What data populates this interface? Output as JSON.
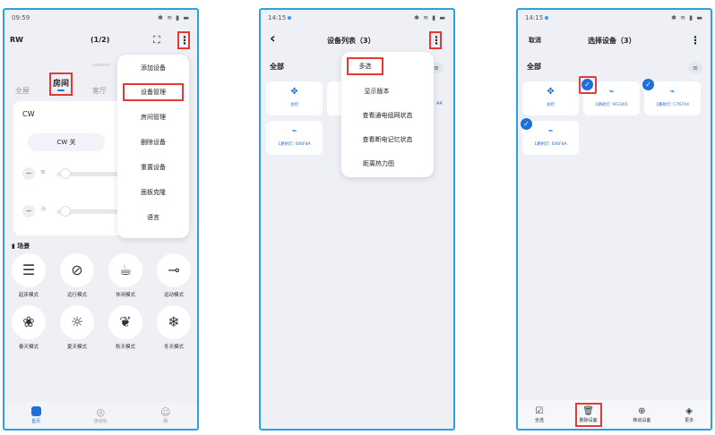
{
  "phone1": {
    "status_time": "09:59",
    "status_icons": "✱ ≋ ▮ ▬",
    "home_name": "RW",
    "page_indicator": "(1/2)",
    "scan_icon": "scan-icon",
    "tabs": [
      "全屋",
      "房间",
      "客厅"
    ],
    "card_title": "CW",
    "cw_toggle_label": "CW 关",
    "brightness_minus": "−",
    "temp_minus": "−",
    "scene_section": "场景",
    "scenes": [
      {
        "label": "起床模式",
        "glyph": "☰"
      },
      {
        "label": "远行模式",
        "glyph": "⊘"
      },
      {
        "label": "休闲模式",
        "glyph": "☕"
      },
      {
        "label": "运动模式",
        "glyph": "⊸"
      },
      {
        "label": "春天模式",
        "glyph": "❀"
      },
      {
        "label": "夏天模式",
        "glyph": "☼"
      },
      {
        "label": "秋天模式",
        "glyph": "❦"
      },
      {
        "label": "冬天模式",
        "glyph": "❄"
      }
    ],
    "menu_items": [
      "添加设备",
      "设备管理",
      "房间管理",
      "删除设备",
      "重置设备",
      "面板克隆",
      "语言"
    ],
    "nav": [
      {
        "label": "首页"
      },
      {
        "label": "自动化",
        "glyph": "◎"
      },
      {
        "label": "我",
        "glyph": "☺"
      }
    ]
  },
  "phone2": {
    "status_time": "14:15",
    "status_icons": "✱ ≋ ▮ ▬",
    "back_glyph": "‹",
    "title": "设备列表（3）",
    "section": "全部",
    "devices": [
      {
        "label": "总控",
        "glyph": "✥"
      },
      {
        "label": "1路射灯: E06F8A",
        "glyph": "⌁"
      }
    ],
    "menu_items": [
      "多选",
      "显示版本",
      "查看通电组网状态",
      "查看断电记忆状态",
      "距离热力图"
    ],
    "hidden_suffix": "A4"
  },
  "phone3": {
    "status_time": "14:15",
    "status_icons": "✱ ≋ ▮ ▬",
    "cancel": "取消",
    "title": "选择设备（3）",
    "section": "全部",
    "devices": [
      {
        "label": "总控",
        "glyph": "✥"
      },
      {
        "label": "1路射灯: 9F2365",
        "glyph": "⌁"
      },
      {
        "label": "1路射灯: C767A4",
        "glyph": "⌁"
      },
      {
        "label": "1路射灯: E06F8A",
        "glyph": "⌁"
      }
    ],
    "bottom_actions": [
      {
        "label": "全选",
        "glyph": "☑"
      },
      {
        "label": "删除设备",
        "glyph": "🗑"
      },
      {
        "label": "移动设备",
        "glyph": "⊕"
      },
      {
        "label": "更多",
        "glyph": "◈"
      }
    ]
  },
  "colors": {
    "accent": "#1e6fd9",
    "frame": "#2ea0e0",
    "highlight": "#e53935"
  }
}
